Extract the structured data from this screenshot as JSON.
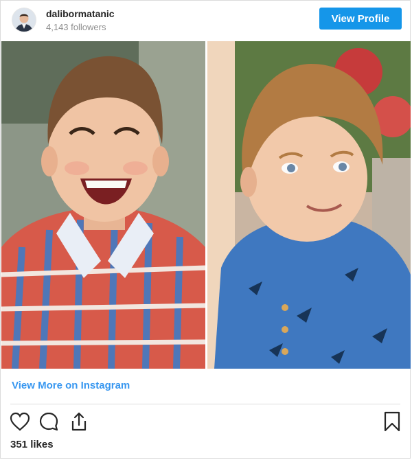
{
  "header": {
    "username": "dalibormatanic",
    "followers": "4,143 followers",
    "view_profile_label": "View Profile"
  },
  "post": {
    "view_more_label": "View More on Instagram",
    "likes": "351 likes"
  },
  "icons": {
    "like": "heart-icon",
    "comment": "comment-icon",
    "share": "share-icon",
    "save": "bookmark-icon"
  },
  "colors": {
    "accent": "#3897f0",
    "button": "#1596e9",
    "text": "#262626",
    "muted": "#8e8e8e",
    "border": "#dbdbdb"
  }
}
